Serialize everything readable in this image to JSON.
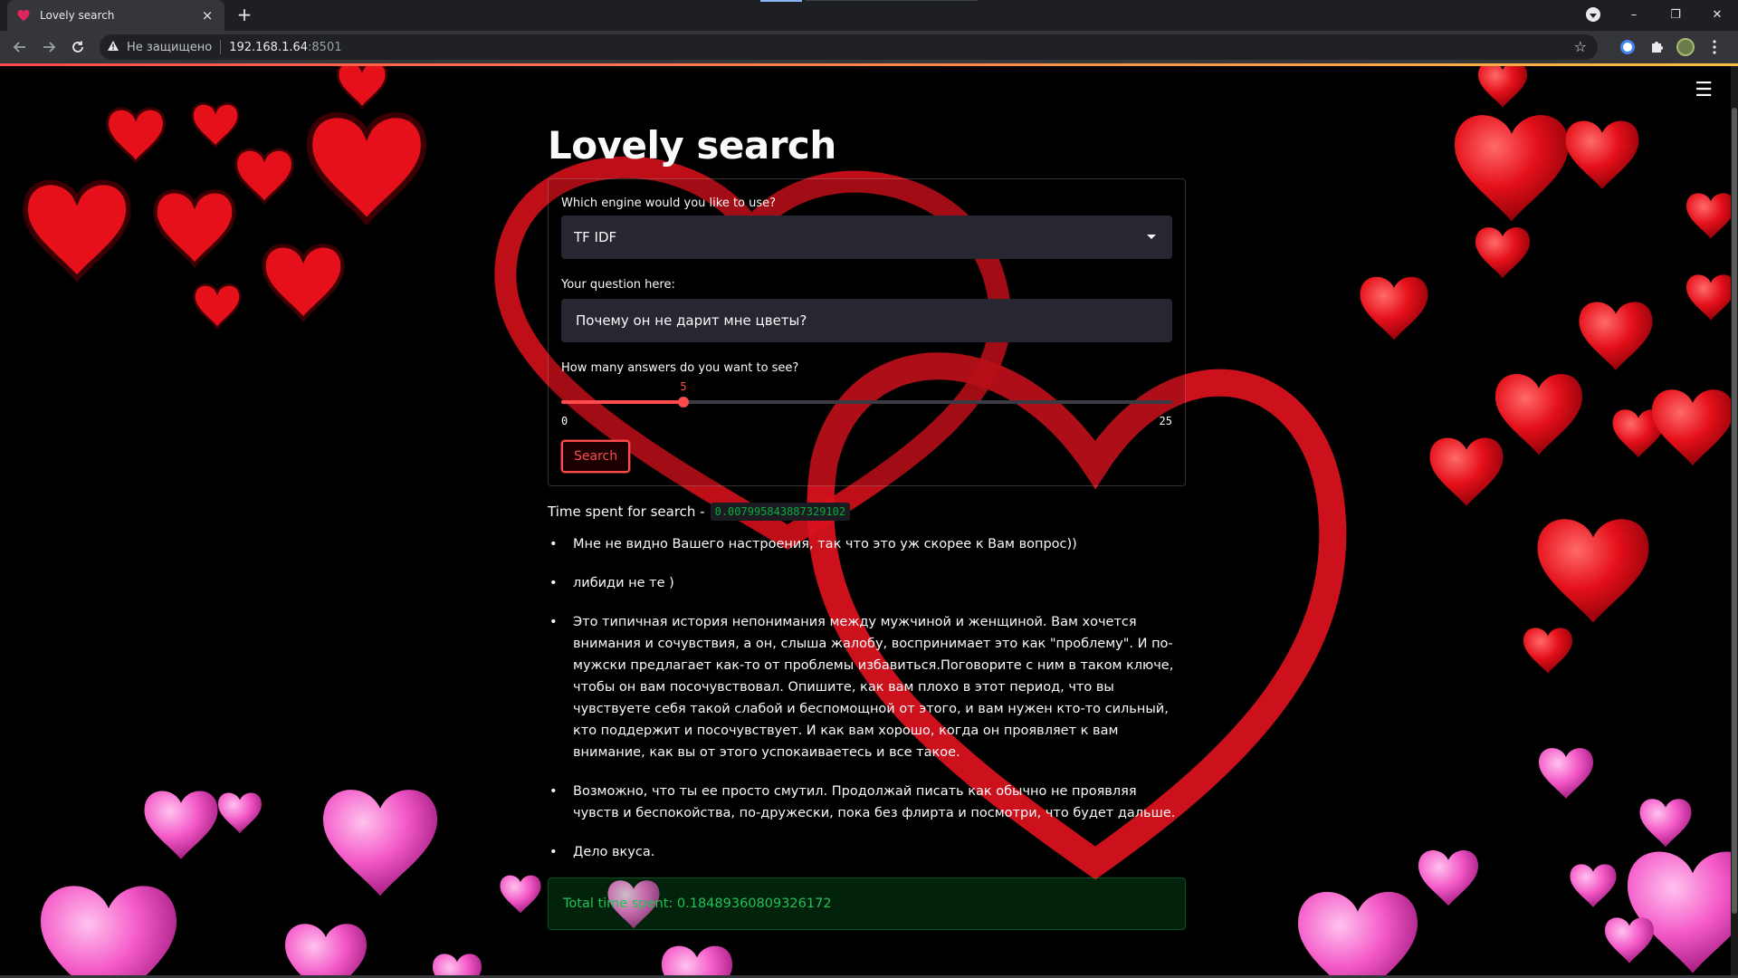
{
  "browser": {
    "tab_title": "Lovely search",
    "tab_close": "×",
    "new_tab": "+",
    "omnibox": {
      "warning_label": "Не защищено",
      "host": "192.168.1.64",
      "port": ":8501"
    },
    "window_controls": [
      "–",
      "❐",
      "✕"
    ]
  },
  "app": {
    "title": "Lovely search",
    "engine_label": "Which engine would you like to use?",
    "engine_selected": "TF IDF",
    "question_label": "Your question here:",
    "question_value": "Почему он не дарит мне цветы?",
    "answers_label": "How many answers do you want to see?",
    "slider": {
      "value": "5",
      "min": "0",
      "max": "25",
      "fraction": 0.2
    },
    "search_button": "Search",
    "time_label": "Time spent for search -",
    "time_value": "0.007995843887329102",
    "answers": [
      "Мне не видно Вашего настроения, так что это уж скорее к Вам вопрос))",
      "либиди не те )",
      "Это типичная история непонимания между мужчиной и женщиной. Вам хочется внимания и сочувствия, а он, слыша жалобу, воспринимает это как \"проблему\". И по-мужски предлагает как-то от проблемы избавиться.Поговорите с ним в таком ключе, чтобы он вам посочувствовал. Опишите, как вам плохо в этот период, что вы чувствуете себя такой слабой и беспомощной от этого, и вам нужен кто-то сильный, кто поддержит и посочувствует. И как вам хорошо, когда он проявляет к вам внимание, как вы от этого успокаиваетесь и все такое.",
      "Возможно, что ты ее просто смутил. Продолжай писать как обычно не проявляя чувств и беспокойства, по-дружески, пока без флирта и посмотри, что будет дальше.",
      "Дело вкуса."
    ],
    "total_time": "Total time spent: 0.18489360809326172"
  },
  "colors": {
    "accent": "#ff4b4b",
    "success": "#21c354",
    "background": "#000000",
    "input_bg": "#262730"
  },
  "icons": [
    "heart-favicon-icon",
    "back-arrow-icon",
    "forward-arrow-icon",
    "reload-icon",
    "warning-icon",
    "bookmark-star-icon",
    "extension-icon",
    "puzzle-icon",
    "avatar-icon",
    "menu-dots-icon",
    "hamburger-menu-icon"
  ]
}
